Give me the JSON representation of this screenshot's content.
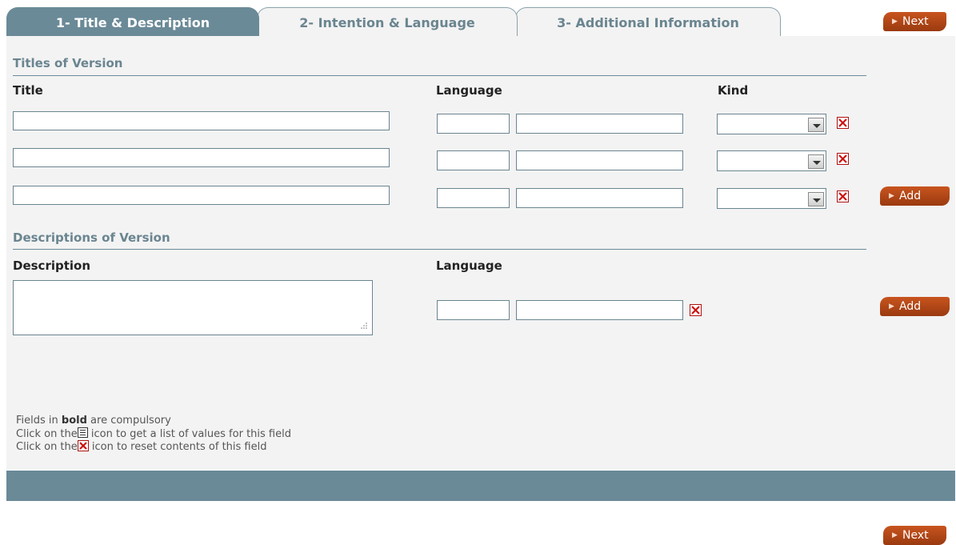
{
  "tabs": [
    {
      "label": "1- Title & Description"
    },
    {
      "label": "2- Intention & Language"
    },
    {
      "label": "3- Additional Information"
    }
  ],
  "buttons": {
    "next_top": "Next",
    "next_bottom": "Next",
    "add_titles": "Add",
    "add_descriptions": "Add"
  },
  "titles_section": {
    "heading": "Titles of Version",
    "col_title": "Title",
    "col_language": "Language",
    "col_kind": "Kind"
  },
  "descriptions_section": {
    "heading": "Descriptions of Version",
    "col_description": "Description",
    "col_language": "Language"
  },
  "help": {
    "line1_pre": "Fields in ",
    "line1_bold": "bold",
    "line1_post": " are compulsory",
    "line2_pre": "Click on the",
    "line2_post": " icon to get a list of values for this field",
    "line3_pre": "Click on the",
    "line3_post": " icon to reset contents of this field"
  },
  "icons": {
    "reset": "reset-x-icon",
    "list": "list-values-icon",
    "button_arrow": "triangle-right-icon",
    "dropdown": "chevron-down-icon"
  },
  "colors": {
    "accent": "#6a8a98",
    "button": "#b84a18",
    "reset_icon": "#cc1111"
  }
}
